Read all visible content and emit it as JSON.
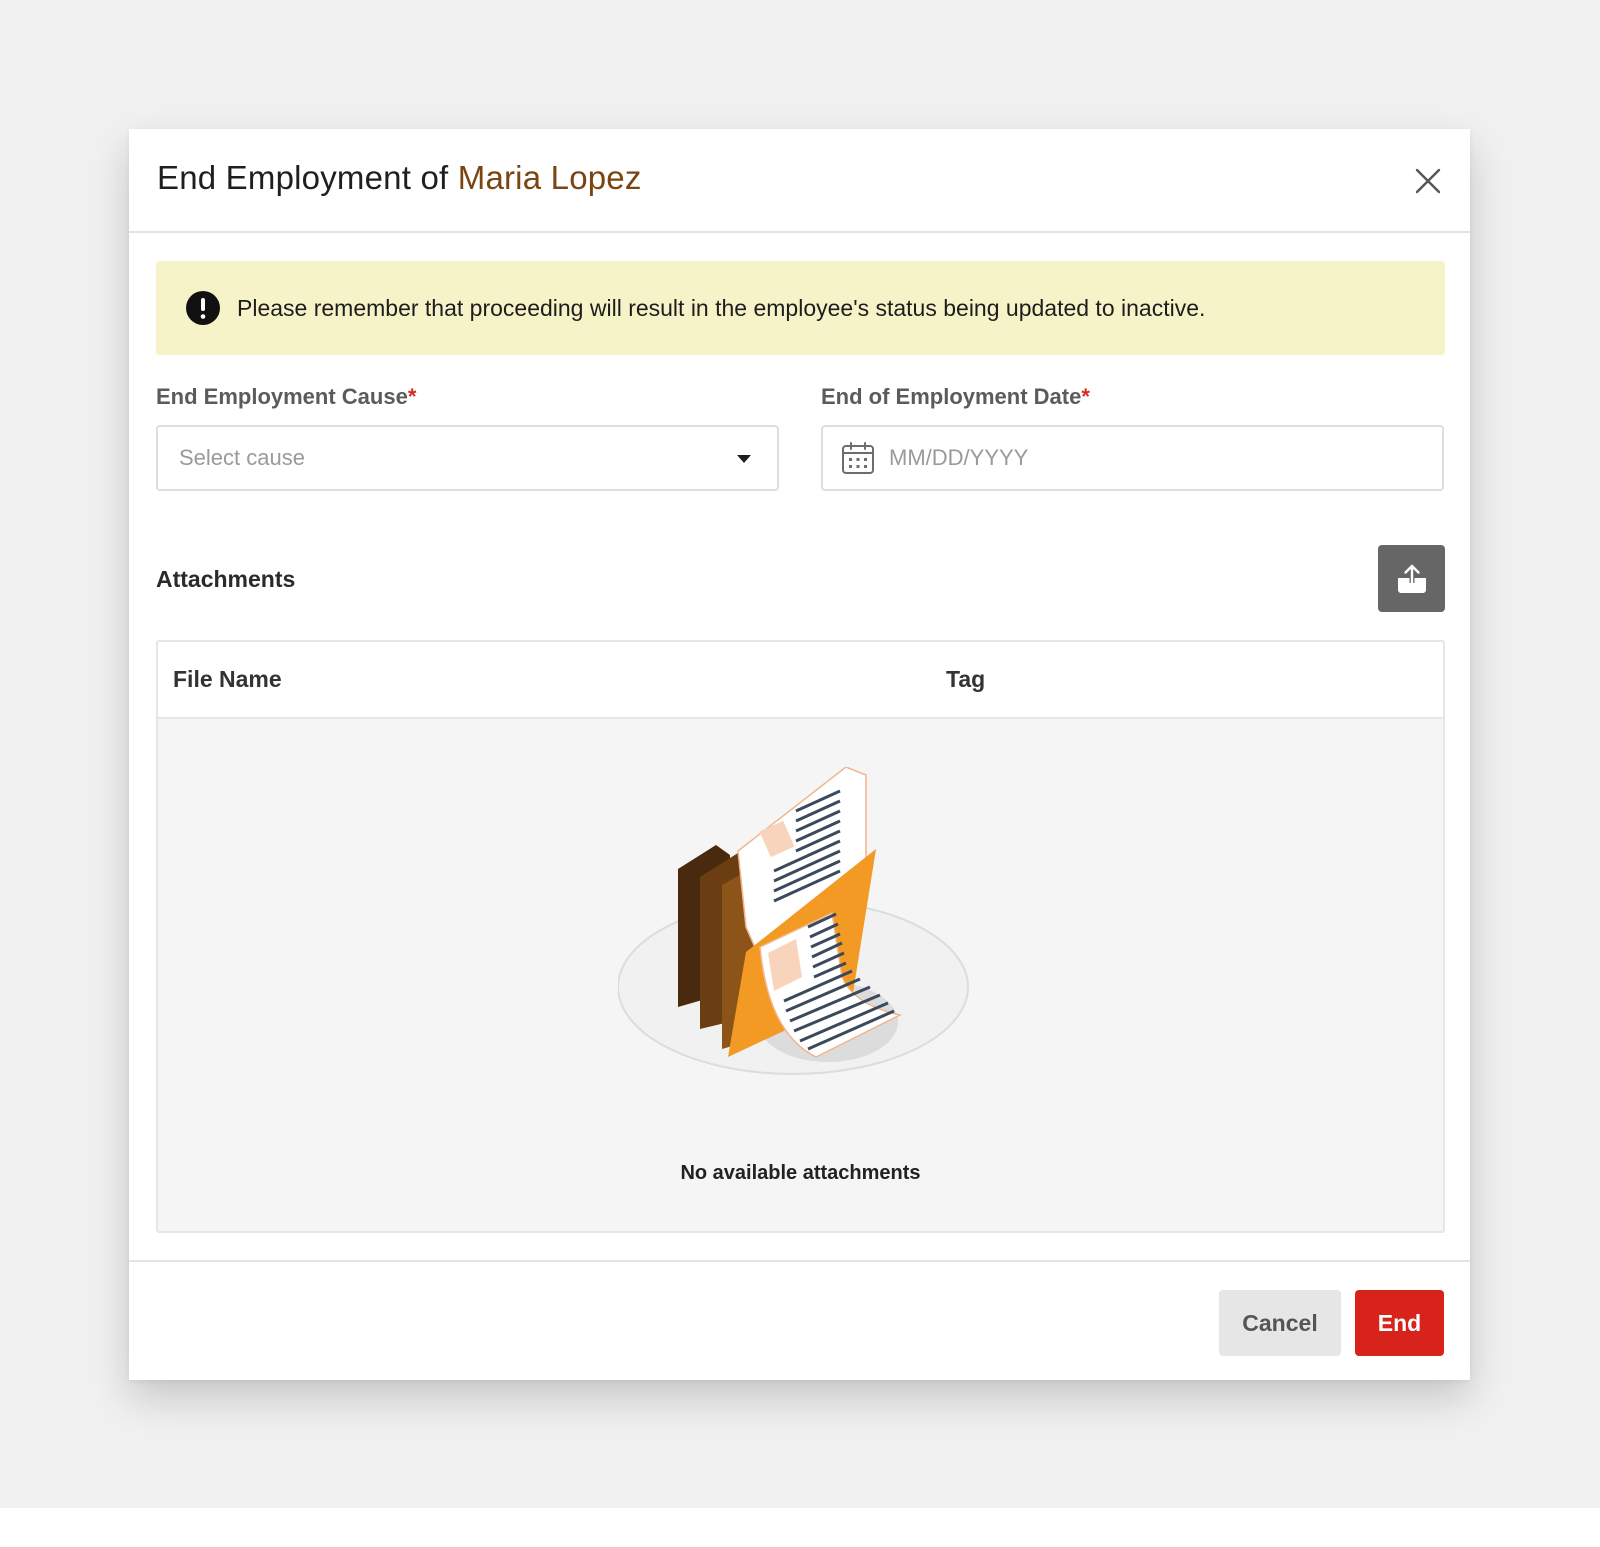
{
  "modal": {
    "title_prefix": "End Employment of ",
    "title_name": "Maria Lopez",
    "close_icon": "close-icon"
  },
  "alert": {
    "icon": "exclamation-circle-icon",
    "text": "Please remember that proceeding will result in the employee's status being updated to inactive."
  },
  "form": {
    "cause": {
      "label": "End Employment Cause",
      "required_mark": "*",
      "placeholder": "Select cause",
      "icon": "chevron-down-icon"
    },
    "date": {
      "label": "End of Employment Date",
      "required_mark": "*",
      "placeholder": "MM/DD/YYYY",
      "icon": "calendar-icon"
    }
  },
  "attachments": {
    "label": "Attachments",
    "upload_icon": "upload-icon",
    "columns": [
      "File Name",
      "Tag"
    ],
    "rows": [],
    "empty_text": "No available attachments"
  },
  "footer": {
    "cancel_label": "Cancel",
    "end_label": "End"
  },
  "colors": {
    "name_accent": "#7a4511",
    "alert_bg": "#f7f3c9",
    "required": "#d62b22",
    "end_button": "#d8231c",
    "upload_button": "#666666"
  }
}
